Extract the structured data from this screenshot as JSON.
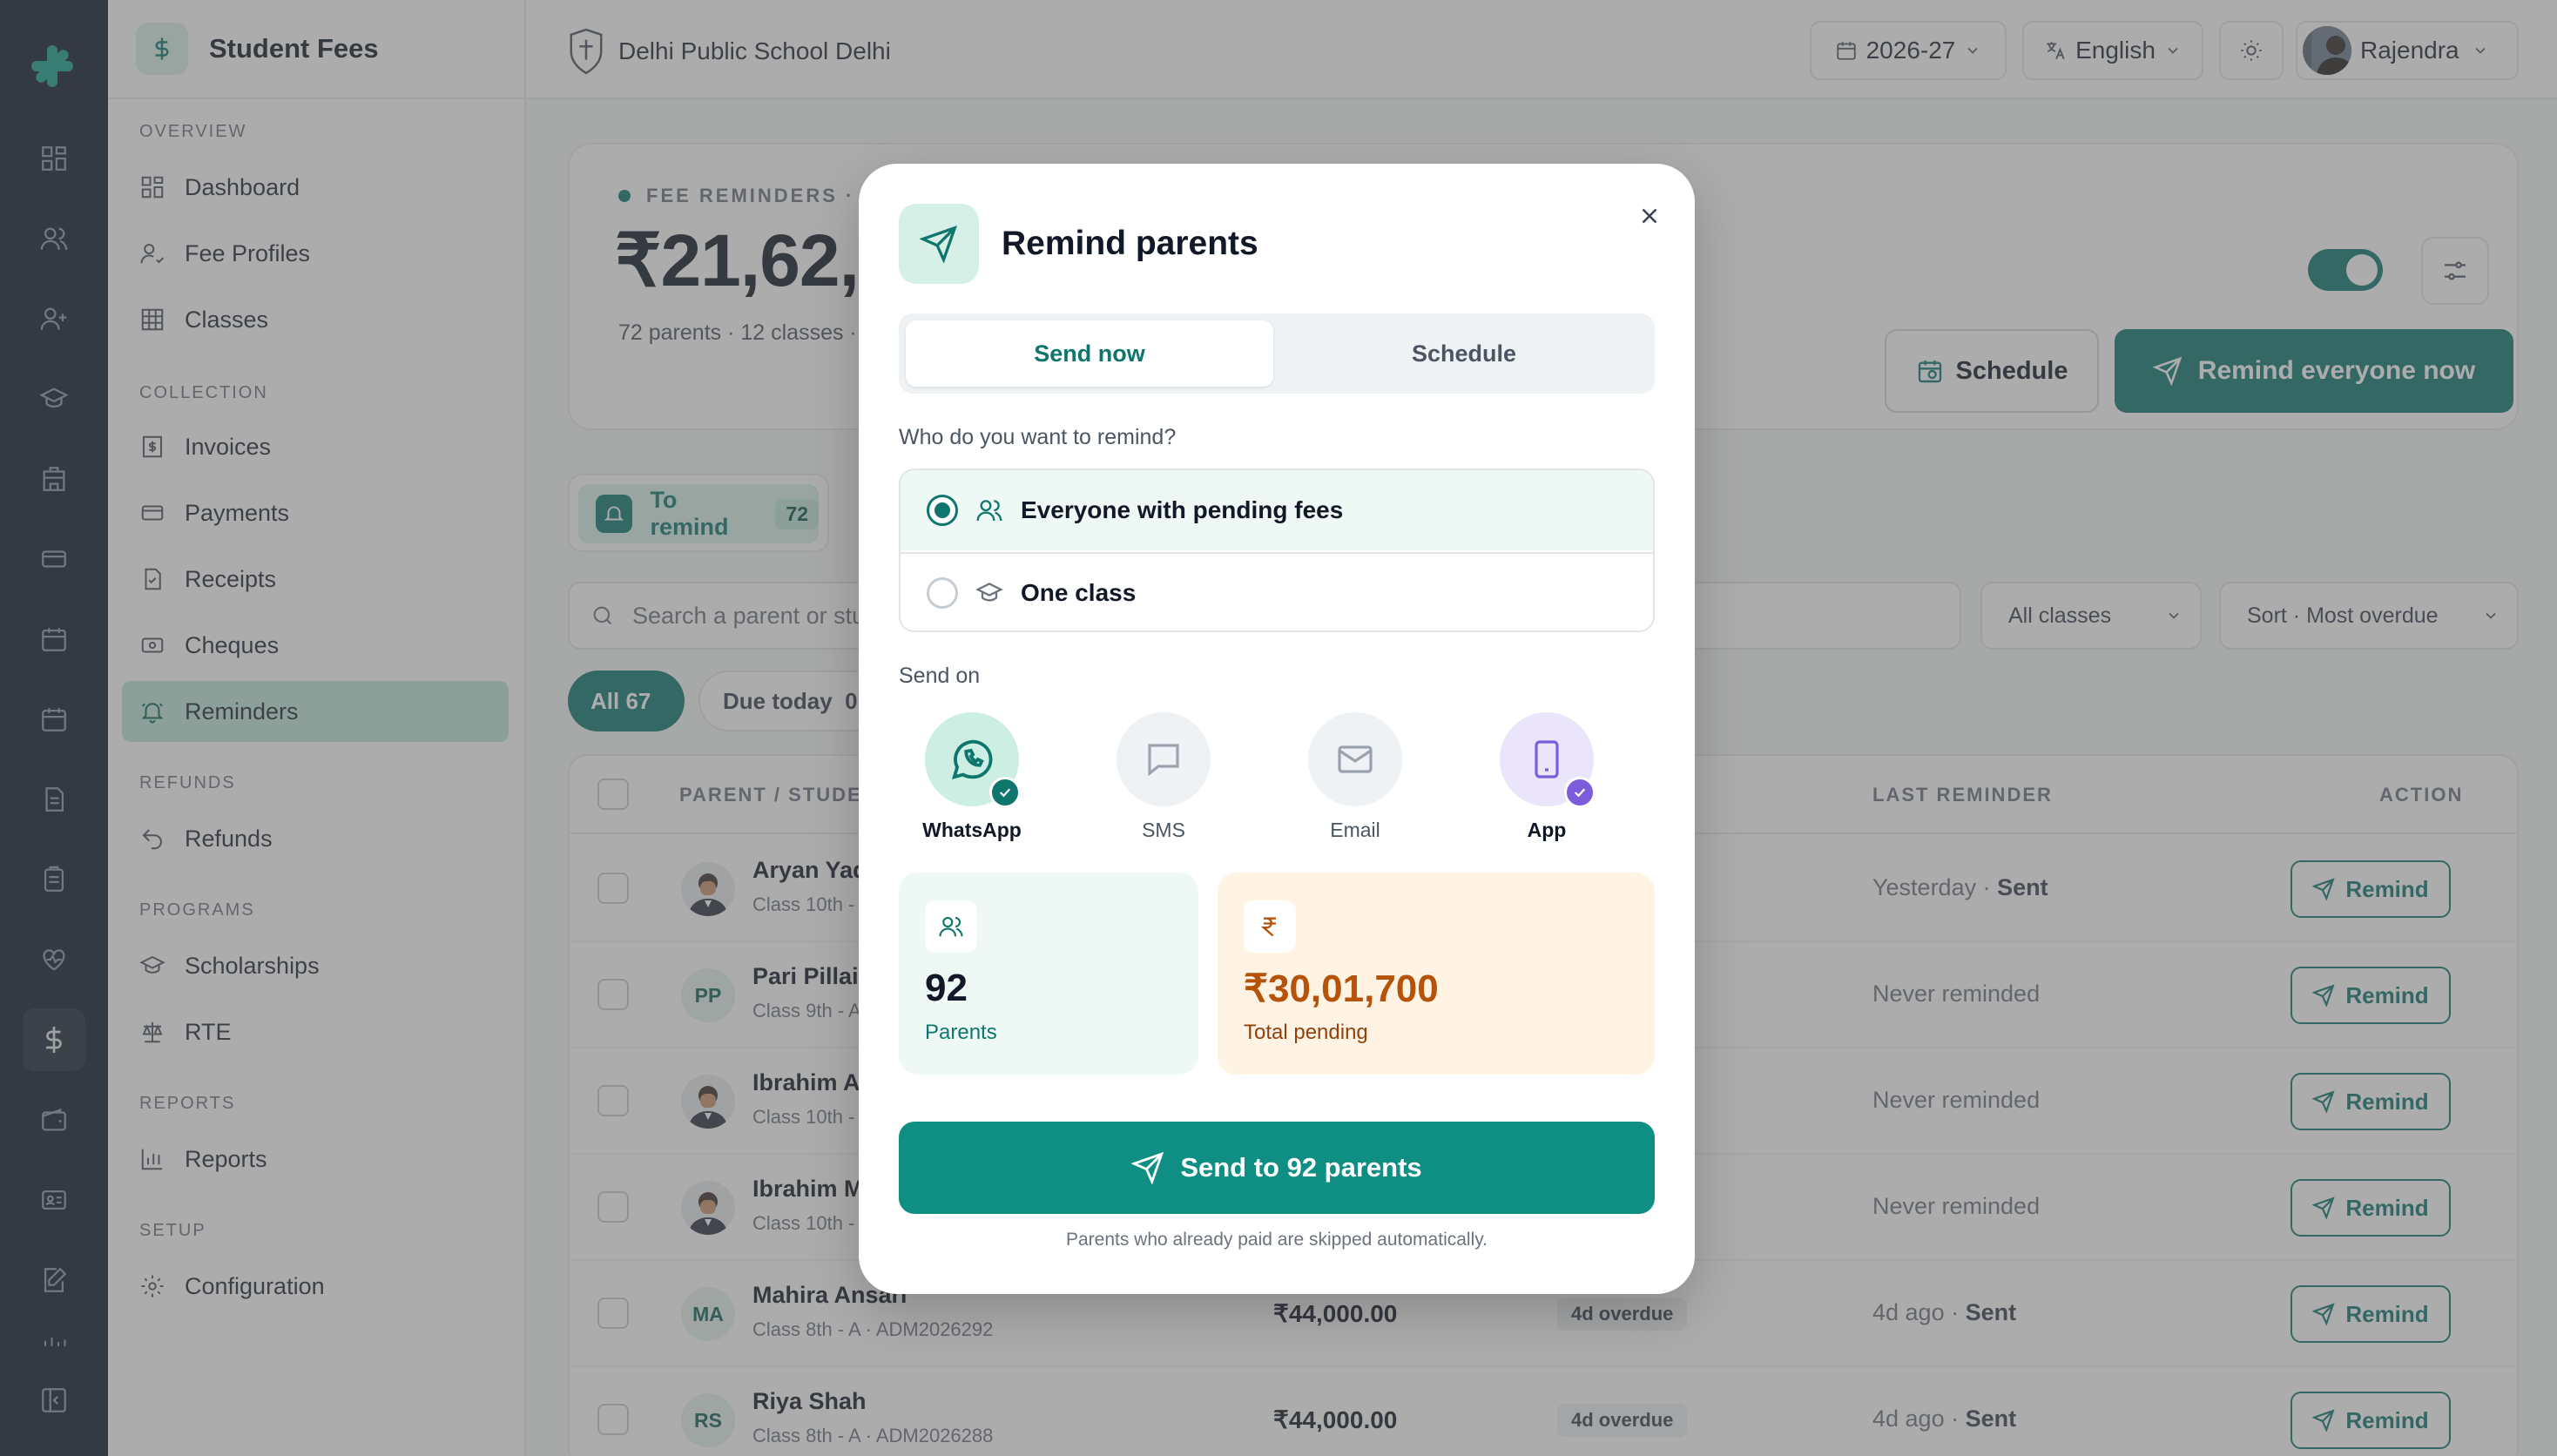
{
  "rail": {
    "icons": [
      "dashboard-icon",
      "users-icon",
      "user-plus-icon",
      "graduation-cap-icon",
      "building-icon",
      "card-icon",
      "calendar-icon",
      "calendar-check-icon",
      "document-icon",
      "clipboard-icon",
      "heart-icon",
      "dollar-icon",
      "wallet-icon",
      "id-card-icon",
      "edit-icon",
      "chart-icon",
      "collapse-sidebar-icon"
    ]
  },
  "sidebar": {
    "title": "Student Fees",
    "sections": [
      {
        "label": "OVERVIEW",
        "items": [
          "Dashboard",
          "Fee Profiles",
          "Classes"
        ]
      },
      {
        "label": "COLLECTION",
        "items": [
          "Invoices",
          "Payments",
          "Receipts",
          "Cheques",
          "Reminders"
        ]
      },
      {
        "label": "REFUNDS",
        "items": [
          "Refunds"
        ]
      },
      {
        "label": "PROGRAMS",
        "items": [
          "Scholarships",
          "RTE"
        ]
      },
      {
        "label": "REPORTS",
        "items": [
          "Reports"
        ]
      },
      {
        "label": "SETUP",
        "items": [
          "Configuration"
        ]
      }
    ],
    "active": "Reminders"
  },
  "topbar": {
    "school": "Delhi Public School Delhi",
    "year": "2026-27",
    "language": "English",
    "user": "Rajendra"
  },
  "hero": {
    "kicker": "FEE REMINDERS ·",
    "amount": "₹21,62,",
    "sub": "72 parents · 12 classes ·",
    "schedule_label": "Schedule",
    "remind_all_label": "Remind everyone now"
  },
  "tabs": {
    "to_remind_label": "To remind",
    "to_remind_count": "72"
  },
  "filters": {
    "search_placeholder": "Search a parent or stu",
    "classes": "All classes",
    "sort": "Sort · Most overdue",
    "chip_all": "All 67",
    "chip_due_today": "Due today  0"
  },
  "table": {
    "headers": {
      "parent": "PARENT / STUDEN",
      "last": "LAST REMINDER",
      "action": "ACTION"
    },
    "action_label": "Remind",
    "rows": [
      {
        "initials": "",
        "photo": true,
        "name": "Aryan Yad",
        "meta": "Class 10th -",
        "amount": "",
        "due": "",
        "last": "Yesterday · ",
        "last_status": "Sent"
      },
      {
        "initials": "PP",
        "photo": false,
        "name": "Pari Pillai",
        "meta": "Class 9th - A",
        "amount": "",
        "due": "",
        "last": "Never reminded",
        "last_status": ""
      },
      {
        "initials": "",
        "photo": true,
        "name": "Ibrahim Ar",
        "meta": "Class 10th -",
        "amount": "",
        "due": "",
        "last": "Never reminded",
        "last_status": ""
      },
      {
        "initials": "",
        "photo": true,
        "name": "Ibrahim M",
        "meta": "Class 10th -",
        "amount": "",
        "due": "",
        "last": "Never reminded",
        "last_status": ""
      },
      {
        "initials": "MA",
        "photo": false,
        "name": "Mahira Ansari",
        "meta": "Class 8th - A · ADM2026292",
        "amount": "₹44,000.00",
        "due": "4d overdue",
        "last": "4d ago · ",
        "last_status": "Sent"
      },
      {
        "initials": "RS",
        "photo": false,
        "name": "Riya Shah",
        "meta": "Class 8th - A · ADM2026288",
        "amount": "₹44,000.00",
        "due": "4d overdue",
        "last": "4d ago · ",
        "last_status": "Sent"
      }
    ]
  },
  "modal": {
    "title": "Remind parents",
    "tab_now": "Send now",
    "tab_schedule": "Schedule",
    "question": "Who do you want to remind?",
    "option_everyone": "Everyone with pending fees",
    "option_class": "One class",
    "send_on": "Send on",
    "channels": [
      {
        "label": "WhatsApp",
        "selected": true
      },
      {
        "label": "SMS",
        "selected": false
      },
      {
        "label": "Email",
        "selected": false
      },
      {
        "label": "App",
        "selected": true
      }
    ],
    "parents_value": "92",
    "parents_label": "Parents",
    "pending_value": "₹30,01,700",
    "pending_label": "Total pending",
    "send_label": "Send to 92 parents",
    "note": "Parents who already paid are skipped automatically."
  },
  "colors": {
    "brand": "#0f766e",
    "send": "#0f8f83",
    "rail": "#0f1a2a",
    "pending_bg": "#fff4e4",
    "pending_text": "#b45309",
    "app_purple": "#7c5cdb"
  }
}
